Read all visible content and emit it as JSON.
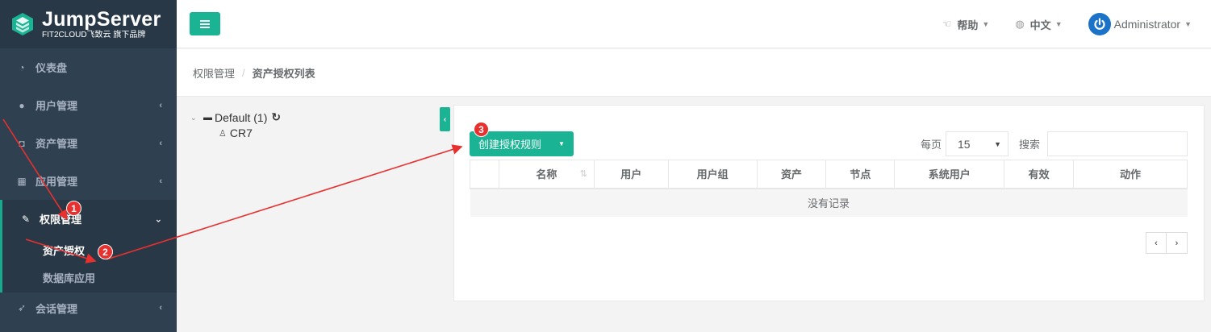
{
  "app": {
    "logo_title": "JumpServer",
    "logo_sub": "FIT2CLOUD飞致云 旗下品牌"
  },
  "sidebar": {
    "items": [
      {
        "label": "仪表盘",
        "icon": "dashboard-icon"
      },
      {
        "label": "用户管理",
        "icon": "users-icon"
      },
      {
        "label": "资产管理",
        "icon": "inbox-icon"
      },
      {
        "label": "应用管理",
        "icon": "grid-icon"
      },
      {
        "label": "权限管理",
        "icon": "edit-icon"
      },
      {
        "label": "会话管理",
        "icon": "rocket-icon"
      }
    ],
    "sub_items": [
      {
        "label": "资产授权"
      },
      {
        "label": "数据库应用"
      }
    ]
  },
  "topbar": {
    "help": "帮助",
    "language": "中文",
    "user": "Administrator"
  },
  "breadcrumb": {
    "parent": "权限管理",
    "separator": "/",
    "current": "资产授权列表"
  },
  "tree": {
    "root_label": "Default (1)",
    "child_label": "CR7"
  },
  "toolbar": {
    "create_label": "创建授权规则",
    "per_page_label": "每页",
    "per_page_value": "15",
    "search_label": "搜索",
    "search_value": ""
  },
  "table": {
    "columns": [
      "",
      "名称",
      "用户",
      "用户组",
      "资产",
      "节点",
      "系统用户",
      "有效",
      "动作"
    ],
    "empty_text": "没有记录"
  },
  "pager": {
    "prev": "‹",
    "next": "›"
  },
  "annotations": [
    {
      "label": "1"
    },
    {
      "label": "2"
    },
    {
      "label": "3"
    }
  ],
  "colors": {
    "sidebar_bg": "#2f4050",
    "sidebar_dark": "#293846",
    "accent": "#1ab394",
    "annotation_red": "#e8302f",
    "user_icon_blue": "#1a73c9"
  }
}
